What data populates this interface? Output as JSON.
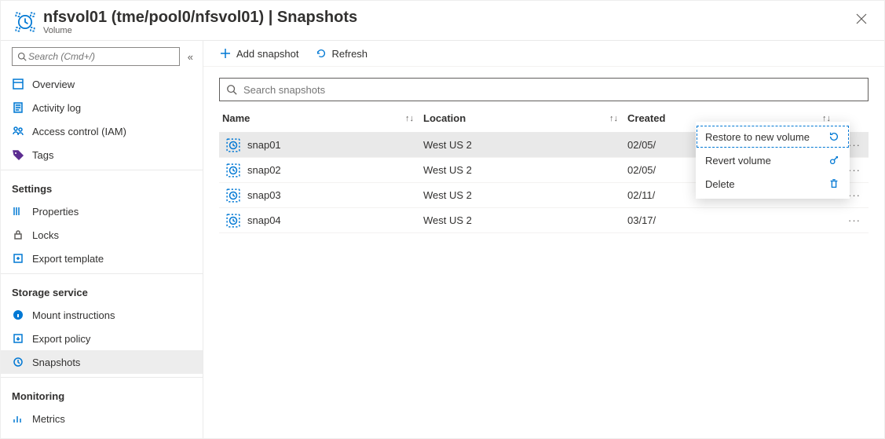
{
  "header": {
    "title": "nfsvol01 (tme/pool0/nfsvol01) | Snapshots",
    "subtitle": "Volume"
  },
  "sidebar": {
    "search_placeholder": "Search (Cmd+/)",
    "top_items": [
      {
        "label": "Overview",
        "icon": "overview-icon"
      },
      {
        "label": "Activity log",
        "icon": "activity-log-icon"
      },
      {
        "label": "Access control (IAM)",
        "icon": "access-control-icon"
      },
      {
        "label": "Tags",
        "icon": "tags-icon"
      }
    ],
    "sections": [
      {
        "title": "Settings",
        "items": [
          {
            "label": "Properties",
            "icon": "properties-icon"
          },
          {
            "label": "Locks",
            "icon": "locks-icon"
          },
          {
            "label": "Export template",
            "icon": "export-template-icon"
          }
        ]
      },
      {
        "title": "Storage service",
        "items": [
          {
            "label": "Mount instructions",
            "icon": "info-icon"
          },
          {
            "label": "Export policy",
            "icon": "export-policy-icon"
          },
          {
            "label": "Snapshots",
            "icon": "snapshot-icon",
            "active": true
          }
        ]
      },
      {
        "title": "Monitoring",
        "items": [
          {
            "label": "Metrics",
            "icon": "metrics-icon"
          }
        ]
      }
    ]
  },
  "toolbar": {
    "add_label": "Add snapshot",
    "refresh_label": "Refresh"
  },
  "search": {
    "placeholder": "Search snapshots"
  },
  "columns": {
    "name": "Name",
    "location": "Location",
    "created": "Created"
  },
  "snapshots": [
    {
      "name": "snap01",
      "location": "West US 2",
      "created": "02/05/",
      "selected": true
    },
    {
      "name": "snap02",
      "location": "West US 2",
      "created": "02/05/",
      "selected": false
    },
    {
      "name": "snap03",
      "location": "West US 2",
      "created": "02/11/",
      "selected": false
    },
    {
      "name": "snap04",
      "location": "West US 2",
      "created": "03/17/",
      "selected": false
    }
  ],
  "context_menu": {
    "restore": "Restore to new volume",
    "revert": "Revert volume",
    "delete": "Delete"
  }
}
